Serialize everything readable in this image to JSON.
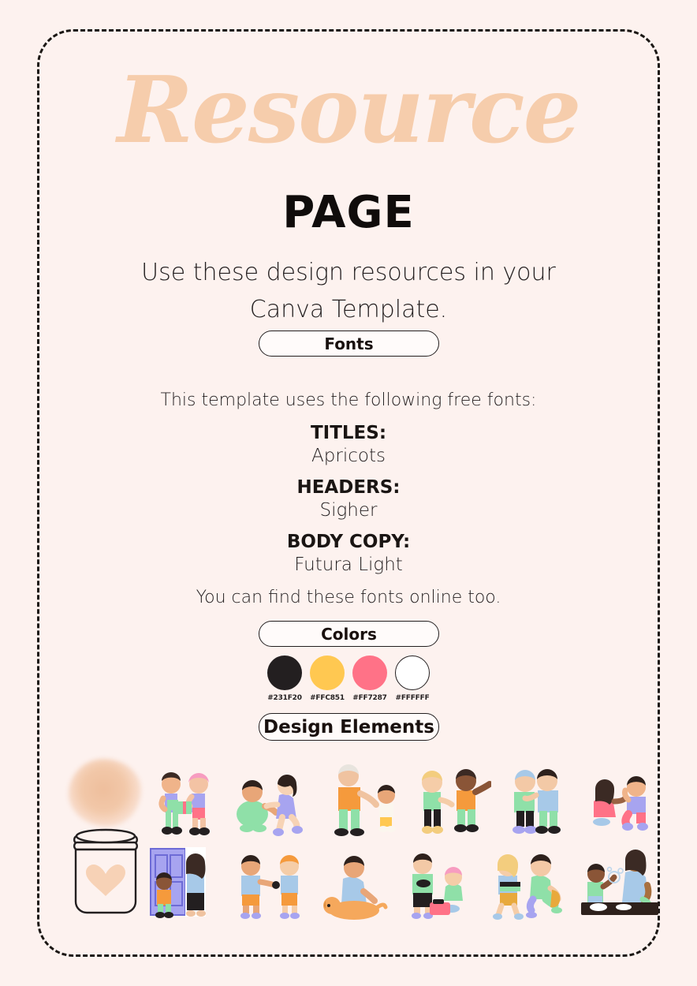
{
  "page": {
    "background_color": "#FDF2EF",
    "frame_color": "#231F20"
  },
  "header": {
    "title_script": "Resource",
    "title_sub": "PAGE",
    "script_color": "#F6CDAC",
    "intro_line_1": "Use these design resources in your",
    "intro_line_2": "Canva Template."
  },
  "sections": {
    "fonts": {
      "pill_label": "Fonts",
      "lead": "This template uses the following free fonts:",
      "groups": [
        {
          "label": "TITLES:",
          "value": "Apricots"
        },
        {
          "label": "HEADERS:",
          "value": "Sigher"
        },
        {
          "label": "BODY COPY:",
          "value": "Futura Light"
        }
      ],
      "footer": "You can find these fonts online too."
    },
    "colors": {
      "pill_label": "Colors",
      "swatches": [
        {
          "hex": "#231F20",
          "label": "#231F20",
          "outlined": false
        },
        {
          "hex": "#FFC851",
          "label": "#FFC851",
          "outlined": false
        },
        {
          "hex": "#FF7287",
          "label": "#FF7287",
          "outlined": false
        },
        {
          "hex": "#FFFFFF",
          "label": "#FFFFFF",
          "outlined": true
        }
      ]
    },
    "design_elements": {
      "pill_label": "Design Elements",
      "illustrations": {
        "jar_art": "mason-jar-with-peach-heart-and-watercolor-blob",
        "row_1": [
          "two-kids-sharing-a-gift",
          "toddler-reaching-for-girl-in-blue-dress",
          "grandparent-walking-with-toddler",
          "blond-toddler-and-boy-in-orange-pointing",
          "two-children-hugging",
          "girl-crouching-and-boy-waving"
        ],
        "row_2": [
          "two-girls-at-a-doorway",
          "boy-and-girl-playing-with-toy",
          "boy-petting-an-orange-dog",
          "boy-with-toy-and-baby-with-bin",
          "two-kids-carrying-books-and-bag",
          "boy-and-woman-washing-dishes"
        ]
      }
    }
  }
}
